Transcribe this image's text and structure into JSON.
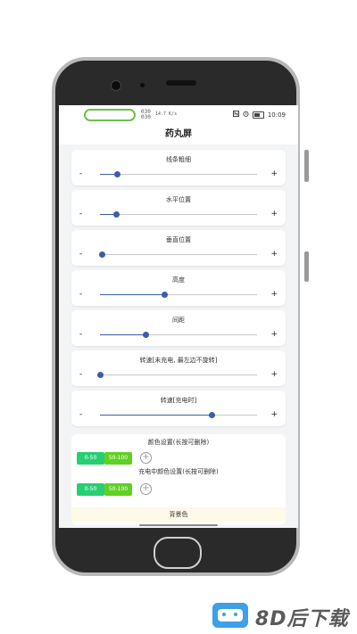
{
  "status_bar": {
    "left_text_line1": "030",
    "left_text_line2": "030",
    "speed": "14.7 K/s",
    "time": "10:09"
  },
  "app": {
    "title": "药丸屏"
  },
  "sliders": [
    {
      "label": "线条粗细",
      "minus": "-",
      "plus": "+",
      "value_percent": 11
    },
    {
      "label": "水平位置",
      "minus": "-",
      "plus": "+",
      "value_percent": 10
    },
    {
      "label": "垂直位置",
      "minus": "-",
      "plus": "+",
      "value_percent": 1
    },
    {
      "label": "高度",
      "minus": "-",
      "plus": "+",
      "value_percent": 41
    },
    {
      "label": "间距",
      "minus": "-",
      "plus": "+",
      "value_percent": 29
    },
    {
      "label": "转速[未充电, 最左边不旋转]",
      "minus": "-",
      "plus": "+",
      "value_percent": 0
    },
    {
      "label": "转速[充电时]",
      "minus": "-",
      "plus": "+",
      "value_percent": 71
    }
  ],
  "color_settings": {
    "title": "颜色设置(长按可删除)",
    "chips": [
      "0-50",
      "50-100"
    ],
    "charging_title": "充电中颜色设置(长按可删除)",
    "charging_chips": [
      "0-50",
      "50-100"
    ],
    "add_symbol": "+",
    "background_label": "背景色"
  },
  "watermark": {
    "brand_text": "8D后下载"
  },
  "colors": {
    "accent": "#3a5fa8",
    "chip_green": "#27cf73",
    "chip_lime": "#5fd024",
    "pill_border": "#6cc04a"
  },
  "icons": [
    "nfc-icon",
    "alarm-icon",
    "signal-icon",
    "wifi-icon",
    "battery-icon",
    "plus-circle-icon"
  ]
}
